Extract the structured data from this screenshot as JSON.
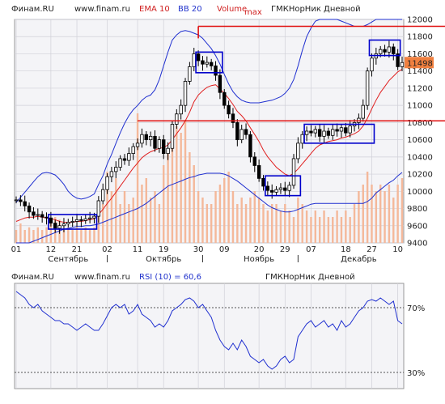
{
  "header": {
    "site": "Финам.RU",
    "url": "www.finam.ru",
    "ema_label": "EMA 10",
    "bb_label": "BB 20",
    "volume_label": "Volume",
    "max_label": "max",
    "ticker": "ГМКНорНик Дневной"
  },
  "rsi_header": {
    "site": "Финам.RU",
    "url": "www.finam.ru",
    "rsi_label": "RSI (10) = 60,6",
    "ticker": "ГМКНорНик Дневной"
  },
  "colors": {
    "background": "#ffffff",
    "plot_bg": "#f4f4f7",
    "candle": "#000000",
    "ema": "#e02020",
    "bollinger": "#2030d0",
    "volume": "#f4b89a",
    "resistance": "#e01010",
    "rsi": "#2030d0",
    "box": "#0000cc",
    "last_price_bg": "#f08040"
  },
  "chart_data": [
    {
      "type": "candlestick",
      "ylim": [
        9400,
        12000
      ],
      "y_ticks": [
        "12000",
        "11800",
        "11600",
        "11400",
        "11200",
        "11000",
        "10800",
        "10600",
        "10400",
        "10200",
        "10000",
        "9800",
        "9600",
        "9400"
      ],
      "last_price": "11498",
      "x_tick_labels": [
        "01",
        "12",
        "21",
        "02",
        "11",
        "19",
        "30",
        "09",
        "20",
        "29",
        "07",
        "18",
        "27",
        "10"
      ],
      "x_tick_index": [
        0,
        8,
        14,
        21,
        28,
        34,
        42,
        48,
        56,
        62,
        68,
        76,
        82,
        88
      ],
      "month_labels": [
        "Сентябрь",
        "Октябрь",
        "Ноябрь",
        "Декабрь"
      ],
      "month_center_index": [
        12,
        34,
        56,
        79
      ],
      "month_sep_index": [
        21,
        43,
        65
      ],
      "close": [
        9900,
        9880,
        9830,
        9760,
        9720,
        9730,
        9700,
        9690,
        9630,
        9570,
        9600,
        9620,
        9640,
        9650,
        9670,
        9660,
        9680,
        9690,
        9710,
        9890,
        10020,
        10170,
        10230,
        10280,
        10380,
        10360,
        10440,
        10520,
        10560,
        10660,
        10600,
        10640,
        10500,
        10600,
        10440,
        10500,
        10780,
        10900,
        11000,
        11280,
        11450,
        11600,
        11520,
        11480,
        11500,
        11460,
        11350,
        11150,
        11000,
        10900,
        10800,
        10600,
        10720,
        10660,
        10400,
        10300,
        10150,
        10060,
        10010,
        9990,
        10020,
        10040,
        10010,
        10070,
        10380,
        10560,
        10660,
        10700,
        10680,
        10720,
        10640,
        10700,
        10650,
        10720,
        10700,
        10740,
        10680,
        10760,
        10800,
        10850,
        11000,
        11400,
        11550,
        11600,
        11650,
        11620,
        11680,
        11600,
        11450,
        11498
      ],
      "ema10": [
        9650,
        9670,
        9690,
        9700,
        9700,
        9710,
        9700,
        9690,
        9680,
        9670,
        9650,
        9640,
        9640,
        9640,
        9650,
        9650,
        9660,
        9670,
        9680,
        9730,
        9790,
        9860,
        9920,
        9990,
        10060,
        10130,
        10200,
        10270,
        10330,
        10390,
        10430,
        10460,
        10480,
        10500,
        10510,
        10540,
        10600,
        10670,
        10740,
        10820,
        10920,
        11040,
        11120,
        11170,
        11210,
        11230,
        11240,
        11190,
        11140,
        11080,
        11010,
        10930,
        10880,
        10820,
        10740,
        10660,
        10580,
        10480,
        10400,
        10340,
        10280,
        10240,
        10200,
        10180,
        10210,
        10260,
        10320,
        10380,
        10440,
        10500,
        10540,
        10560,
        10580,
        10590,
        10600,
        10620,
        10630,
        10650,
        10670,
        10700,
        10760,
        10850,
        10960,
        11060,
        11150,
        11220,
        11290,
        11340,
        11390,
        11420
      ],
      "bb_upper": [
        9870,
        9930,
        9990,
        10050,
        10110,
        10170,
        10210,
        10220,
        10210,
        10190,
        10140,
        10080,
        10000,
        9950,
        9920,
        9910,
        9920,
        9940,
        9970,
        10080,
        10180,
        10320,
        10430,
        10560,
        10680,
        10790,
        10880,
        10950,
        11000,
        11060,
        11100,
        11120,
        11180,
        11300,
        11460,
        11620,
        11760,
        11820,
        11860,
        11870,
        11860,
        11840,
        11820,
        11780,
        11720,
        11660,
        11580,
        11480,
        11360,
        11250,
        11160,
        11100,
        11060,
        11040,
        11030,
        11030,
        11030,
        11040,
        11050,
        11060,
        11080,
        11100,
        11140,
        11200,
        11300,
        11460,
        11640,
        11800,
        11900,
        11980,
        12000,
        12000,
        12000,
        12000,
        12000,
        11980,
        11960,
        11940,
        11920,
        11920,
        11920,
        11940,
        11970,
        12000,
        12000,
        12000,
        12000,
        12000,
        12000,
        12000
      ],
      "bb_lower": [
        9400,
        9400,
        9400,
        9400,
        9420,
        9440,
        9460,
        9480,
        9500,
        9520,
        9540,
        9560,
        9570,
        9580,
        9590,
        9590,
        9600,
        9600,
        9610,
        9620,
        9640,
        9660,
        9680,
        9700,
        9720,
        9740,
        9760,
        9780,
        9800,
        9830,
        9860,
        9900,
        9940,
        9980,
        10020,
        10060,
        10080,
        10100,
        10120,
        10140,
        10160,
        10170,
        10190,
        10200,
        10210,
        10210,
        10210,
        10210,
        10200,
        10180,
        10150,
        10120,
        10080,
        10040,
        10000,
        9960,
        9920,
        9880,
        9840,
        9810,
        9790,
        9770,
        9760,
        9760,
        9770,
        9790,
        9810,
        9830,
        9850,
        9860,
        9860,
        9860,
        9860,
        9860,
        9860,
        9860,
        9860,
        9860,
        9860,
        9860,
        9860,
        9880,
        9920,
        9980,
        10020,
        10060,
        10100,
        10130,
        10180,
        10220
      ],
      "volume_rel": [
        0.1,
        0.15,
        0.1,
        0.12,
        0.1,
        0.12,
        0.1,
        0.12,
        0.15,
        0.2,
        0.18,
        0.1,
        0.12,
        0.1,
        0.12,
        0.1,
        0.12,
        0.1,
        0.12,
        0.25,
        0.3,
        0.55,
        0.4,
        0.5,
        0.3,
        0.4,
        0.3,
        0.35,
        1.0,
        0.45,
        0.5,
        0.35,
        0.4,
        0.3,
        0.6,
        0.7,
        0.8,
        0.9,
        0.85,
        0.95,
        0.7,
        0.6,
        0.4,
        0.35,
        0.3,
        0.3,
        0.4,
        0.45,
        0.5,
        0.55,
        0.4,
        0.3,
        0.35,
        0.3,
        0.35,
        0.4,
        0.35,
        0.3,
        0.25,
        0.3,
        0.3,
        0.25,
        0.3,
        0.25,
        0.2,
        0.35,
        0.3,
        0.25,
        0.2,
        0.25,
        0.2,
        0.25,
        0.2,
        0.2,
        0.25,
        0.2,
        0.25,
        0.2,
        0.3,
        0.4,
        0.45,
        0.55,
        0.45,
        0.4,
        0.45,
        0.4,
        0.45,
        0.35,
        0.45,
        0.5
      ],
      "resistance_levels": [
        {
          "y": 11920,
          "from_index": 42,
          "to_index": 90
        },
        {
          "y": 10820,
          "from_index": 28,
          "to_index": 90
        }
      ],
      "boxes": [
        {
          "from_index": 8,
          "to_index": 18,
          "y_low": 9560,
          "y_high": 9730
        },
        {
          "from_index": 42,
          "to_index": 47,
          "y_low": 11380,
          "y_high": 11620
        },
        {
          "from_index": 58,
          "to_index": 65,
          "y_low": 9950,
          "y_high": 10180
        },
        {
          "from_index": 67,
          "to_index": 82,
          "y_low": 10560,
          "y_high": 10780
        },
        {
          "from_index": 82,
          "to_index": 88,
          "y_low": 11580,
          "y_high": 11760
        }
      ]
    },
    {
      "type": "line",
      "title": "RSI (10) = 60,6",
      "ylim": [
        20,
        85
      ],
      "levels": [
        70,
        30
      ],
      "level_labels": [
        "70%",
        "30%"
      ],
      "values": [
        80,
        78,
        76,
        72,
        70,
        72,
        68,
        66,
        64,
        62,
        62,
        60,
        60,
        58,
        56,
        58,
        60,
        58,
        56,
        56,
        60,
        65,
        70,
        72,
        70,
        72,
        66,
        68,
        72,
        66,
        64,
        62,
        58,
        60,
        58,
        62,
        68,
        70,
        72,
        75,
        76,
        74,
        70,
        72,
        68,
        64,
        56,
        50,
        46,
        44,
        48,
        44,
        50,
        46,
        40,
        38,
        36,
        38,
        34,
        32,
        34,
        38,
        40,
        36,
        38,
        52,
        56,
        60,
        62,
        58,
        60,
        62,
        58,
        60,
        56,
        62,
        58,
        60,
        64,
        68,
        70,
        74,
        75,
        74,
        76,
        74,
        72,
        74,
        62,
        60
      ]
    }
  ]
}
